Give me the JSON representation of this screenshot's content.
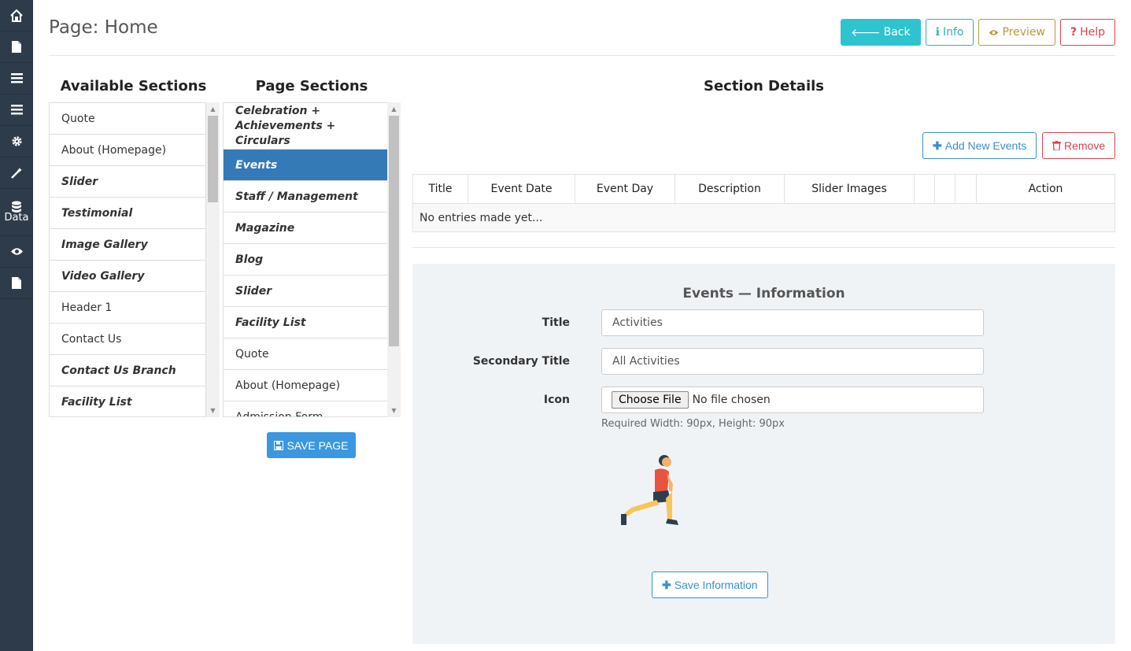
{
  "sidebar": {
    "items": [
      {
        "icon": "home-icon",
        "label": ""
      },
      {
        "icon": "file-icon",
        "label": ""
      },
      {
        "icon": "list-icon",
        "label": ""
      },
      {
        "icon": "list-icon",
        "label": ""
      },
      {
        "icon": "gear-icon",
        "label": ""
      },
      {
        "icon": "magic-wand-icon",
        "label": ""
      },
      {
        "icon": "database-icon",
        "label": "Data"
      },
      {
        "icon": "eye-icon",
        "label": ""
      },
      {
        "icon": "file-icon",
        "label": ""
      }
    ]
  },
  "header": {
    "title": "Page: Home",
    "buttons": {
      "back": "Back",
      "info": "Info",
      "preview": "Preview",
      "help": "Help"
    }
  },
  "available_sections": {
    "title": "Available Sections",
    "items": [
      {
        "label": "Quote",
        "italic": false
      },
      {
        "label": "About (Homepage)",
        "italic": false
      },
      {
        "label": "Slider",
        "italic": true
      },
      {
        "label": "Testimonial",
        "italic": true
      },
      {
        "label": "Image Gallery",
        "italic": true
      },
      {
        "label": "Video Gallery",
        "italic": true
      },
      {
        "label": "Header 1",
        "italic": false
      },
      {
        "label": "Contact Us",
        "italic": false
      },
      {
        "label": "Contact Us Branch",
        "italic": true
      },
      {
        "label": "Facility List",
        "italic": true
      }
    ]
  },
  "page_sections": {
    "title": "Page Sections",
    "items": [
      {
        "label": "Celebration + Achievements + Circulars",
        "italic": true,
        "active": false
      },
      {
        "label": "Events",
        "italic": true,
        "active": true
      },
      {
        "label": "Staff / Management",
        "italic": true,
        "active": false
      },
      {
        "label": "Magazine",
        "italic": true,
        "active": false
      },
      {
        "label": "Blog",
        "italic": true,
        "active": false
      },
      {
        "label": "Slider",
        "italic": true,
        "active": false
      },
      {
        "label": "Facility List",
        "italic": true,
        "active": false
      },
      {
        "label": "Quote",
        "italic": false,
        "active": false
      },
      {
        "label": "About (Homepage)",
        "italic": false,
        "active": false
      },
      {
        "label": "Admission Form",
        "italic": false,
        "active": false
      }
    ],
    "save_label": "SAVE PAGE"
  },
  "section_details": {
    "title": "Section Details",
    "add_label": "Add New Events",
    "remove_label": "Remove",
    "table": {
      "columns": [
        "Title",
        "Event Date",
        "Event Day",
        "Description",
        "Slider Images",
        "",
        "",
        "",
        "Action"
      ],
      "empty_text": "No entries made yet..."
    }
  },
  "form": {
    "title": "Events — Information",
    "title_label": "Title",
    "title_value": "Activities",
    "secondary_label": "Secondary Title",
    "secondary_value": "All Activities",
    "icon_label": "Icon",
    "choose_file": "Choose File",
    "no_file": "No file chosen",
    "help": "Required Width: 90px, Height: 90px",
    "save_label": "Save Information"
  },
  "colors": {
    "sidebar": "#2e3b4a",
    "active": "#337ab7",
    "back": "#2ec4cf",
    "primary": "#3a97e0",
    "danger": "#d9434d"
  }
}
